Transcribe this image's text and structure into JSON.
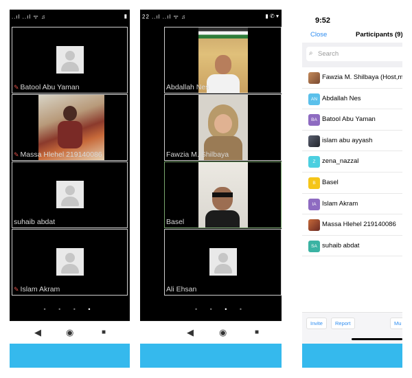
{
  "screen1": {
    "status_left": "..ıl ..ıl ᯤ ♫",
    "status_right": "▮",
    "tiles": [
      {
        "name": "Batool Abu Yaman",
        "muted": true
      },
      {
        "name": "Massa Hlehel 219140086",
        "muted": true
      },
      {
        "name": "suhaib abdat",
        "muted": false
      },
      {
        "name": "Islam Akram",
        "muted": true
      }
    ]
  },
  "screen2": {
    "status_left": "22 ..ıl ..ıl ᯤ ♫",
    "status_right": "▮ ✆ ▾",
    "tiles": [
      {
        "name": "Abdallah Nes"
      },
      {
        "name": "Fawzia M. Shilbaya"
      },
      {
        "name": "Basel"
      },
      {
        "name": "Ali Ehsan"
      }
    ]
  },
  "pager": {
    "dots": "• • • •"
  },
  "nav": {
    "back": "◀",
    "home": "◉",
    "recents": "■"
  },
  "participants": {
    "time": "9:52",
    "close_label": "Close",
    "title": "Participants (9)",
    "search_placeholder": "Search",
    "people": [
      {
        "name": "Fawzia M. Shilbaya (Host,me)",
        "initials": "",
        "color": "#b07c4f",
        "photo": true
      },
      {
        "name": "Abdallah Nes",
        "initials": "AN",
        "color": "#5bc0eb"
      },
      {
        "name": "Batool Abu Yaman",
        "initials": "BA",
        "color": "#8e6bc1"
      },
      {
        "name": "islam abu ayyash",
        "initials": "",
        "color": "#3a3f4a",
        "photo": true
      },
      {
        "name": "zena_nazzal",
        "initials": "Z",
        "color": "#4ccfe0"
      },
      {
        "name": "Basel",
        "initials": "B",
        "color": "#f5c518"
      },
      {
        "name": "Islam Akram",
        "initials": "IA",
        "color": "#8e6bc1"
      },
      {
        "name": "Massa Hlehel 219140086",
        "initials": "",
        "color": "#8a3a2a",
        "photo": true
      },
      {
        "name": "suhaib abdat",
        "initials": "SA",
        "color": "#3bb3a3"
      }
    ],
    "invite_label": "Invite",
    "report_label": "Report",
    "mute_label": "Mu"
  },
  "colors": {
    "accent_blue": "#35b9ed",
    "link_blue": "#2d8cf0",
    "active_tile": "#7aa86f"
  }
}
